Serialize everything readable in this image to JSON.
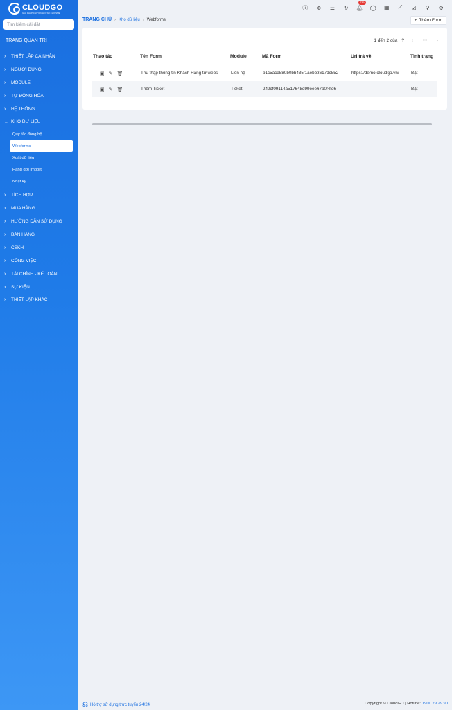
{
  "brand": {
    "name": "CLOUDGO",
    "slogan": "GIẢI PHÁP CHUYỂN ĐỔI SỐ CHO SME"
  },
  "sidebar": {
    "search_placeholder": "Tìm kiếm cài đặt",
    "admin_title": "TRANG QUẢN TRỊ",
    "items_before": [
      {
        "label": "THIẾT LẬP CÁ NHÂN"
      },
      {
        "label": "NGƯỜI DÙNG"
      },
      {
        "label": "MODULE"
      },
      {
        "label": "TỰ ĐỘNG HÓA"
      },
      {
        "label": "HỆ THỐNG"
      }
    ],
    "expanded": {
      "label": "KHO DỮ LIỆU",
      "children": [
        {
          "label": "Quy tắc đồng bộ"
        },
        {
          "label": "Webforms"
        },
        {
          "label": "Xuất dữ liệu"
        },
        {
          "label": "Hàng đợi Import"
        },
        {
          "label": "Nhật ký"
        }
      ]
    },
    "items_after": [
      {
        "label": "TÍCH HỢP"
      },
      {
        "label": "MUA HÀNG"
      },
      {
        "label": "HƯỚNG DẪN SỬ DỤNG"
      },
      {
        "label": "BÁN HÀNG"
      },
      {
        "label": "CSKH"
      },
      {
        "label": "CÔNG VIỆC"
      },
      {
        "label": "TÀI CHÍNH - KẾ TOÁN"
      },
      {
        "label": "SỰ KIỆN"
      },
      {
        "label": "THIẾT LẬP KHÁC"
      }
    ],
    "support": "Hỗ trợ sử dụng trực tuyến 24/24"
  },
  "topbar": {
    "notification_badge": "739"
  },
  "breadcrumb": {
    "home": "TRANG CHỦ",
    "section": "Kho dữ liệu",
    "current": "Webforms"
  },
  "add_form_label": "Thêm Form",
  "pager": {
    "text": "1 đến 2 của",
    "help": "?"
  },
  "table": {
    "headers": {
      "actions": "Thao tác",
      "name": "Tên Form",
      "module": "Module",
      "code": "Mã Form",
      "return_url": "Url trả về",
      "status": "Tình trạng"
    },
    "rows": [
      {
        "name": "Thu thập thông tin Khách Hàng từ webs",
        "module": "Liên hệ",
        "code": "b1c5ac9580b0bb435f1aebb3617dc552",
        "return_url": "https://demo.cloudgo.vn/",
        "status": "Bật"
      },
      {
        "name": "Thêm Ticket",
        "module": "Ticket",
        "code": "249cf09114a517648d99eee67b0f4fd6",
        "return_url": "",
        "status": "Bật"
      }
    ]
  },
  "footer": {
    "copyright": "Copyright © CloudGO | Hotline:",
    "hotline": "1900 29 29 90"
  }
}
